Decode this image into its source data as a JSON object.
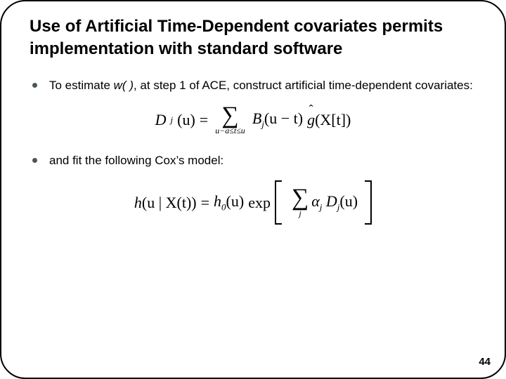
{
  "title": "Use of Artificial Time-Dependent covariates permits implementation with standard software",
  "bullets": [
    {
      "prefix": "To estimate ",
      "emph": "w( )",
      "suffix": ", at step 1 of ACE, construct artificial time-dependent covariates:"
    },
    {
      "prefix": "and fit the following Cox’s model:",
      "emph": "",
      "suffix": ""
    }
  ],
  "eq1": {
    "lhs_D": "D",
    "lhs_sub": "j",
    "lhs_arg": "(u)",
    "eq": " = ",
    "sum_below": "u−a≤t≤u",
    "B": "B",
    "B_sub": "j",
    "B_arg": "(u − t)",
    "g": "g",
    "g_arg": "(X[t])"
  },
  "eq2": {
    "h": "h",
    "h_arg": "(u | X(t))",
    "eq": " = ",
    "h0": "h",
    "h0_sub": "0",
    "h0_arg": "(u)",
    "exp": "exp",
    "sum_below": "j",
    "alpha": "α",
    "alpha_sub": "j",
    "D": "D",
    "D_sub": "j",
    "D_arg": "(u)"
  },
  "page_number": "44"
}
